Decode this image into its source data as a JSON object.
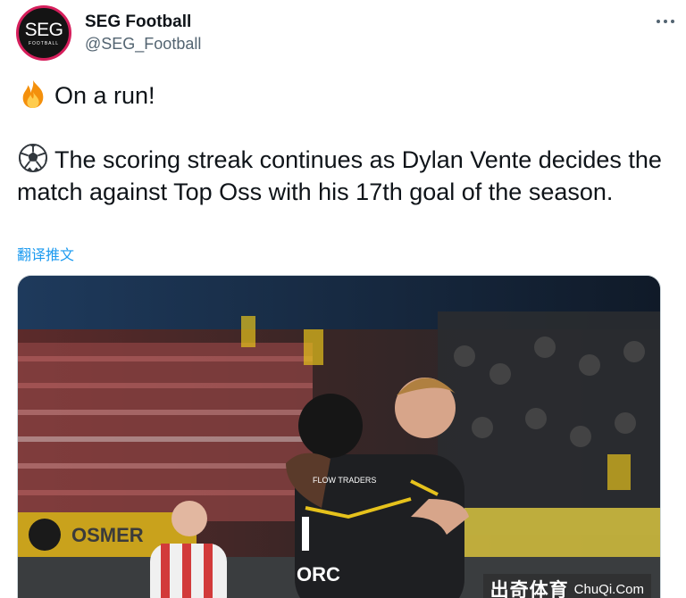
{
  "author": {
    "display_name": "SEG Football",
    "handle": "@SEG_Football",
    "avatar_text": "SEG",
    "avatar_subtext": "FOOTBALL"
  },
  "tweet": {
    "line1": "On a run!",
    "line1_icon": "fire-emoji",
    "para2": "The scoring streak continues as Dylan Vente decides the match against Top Oss with his 17th goal of the season.",
    "para2_icon": "soccer-ball-emoji"
  },
  "translate_label": "翻译推文",
  "media": {
    "jersey_sponsor": "ORC",
    "jersey_text": "FLOW TRADERS",
    "board_text": "OSMER"
  },
  "watermark": {
    "cn": "出奇体育",
    "en": "ChuQi.Com"
  },
  "colors": {
    "link": "#1d9bf0",
    "text": "#0f1419",
    "secondary": "#536471",
    "avatar_ring": "#d61f5c"
  }
}
